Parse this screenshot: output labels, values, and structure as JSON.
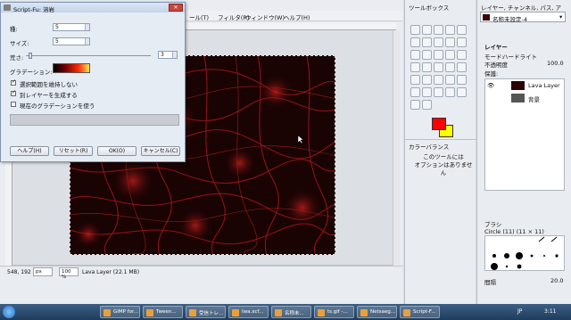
{
  "main": {
    "menus": [
      "ール(T)",
      "フィルタ(R)",
      "ウィンドウ(W)",
      "ヘルプ(H)"
    ],
    "status": {
      "coords": "548, 192",
      "unit": "px",
      "zoom": "100 %",
      "layer": "Lava Layer (22.1 MB)"
    }
  },
  "dialog": {
    "title": "Script-Fu: 溶岩",
    "seed_label": "種:",
    "seed_value": "5",
    "size_label": "サイズ:",
    "size_value": "5",
    "rough_label": "荒さ:",
    "rough_value": "3",
    "gradient_label": "グラデーション:",
    "checks": [
      {
        "label": "選択範囲を維持しない",
        "checked": true
      },
      {
        "label": "別レイヤーを生成する",
        "checked": true
      },
      {
        "label": "現在のグラデーションを使う",
        "checked": false
      }
    ],
    "buttons": {
      "help": "ヘルプ(H)",
      "reset": "リセット(R)",
      "ok": "OK(O)",
      "cancel": "キャンセル(C)"
    }
  },
  "toolbox": {
    "title": "ツールボックス",
    "color_balance": "カラーバランス",
    "hint": "このツールには\nオプションはありません"
  },
  "layers": {
    "title": "レイヤー, チャンネル, パス, アン...",
    "image_name": "名称未設定-4",
    "tab": "レイヤー",
    "mode_label": "モード:",
    "mode_value": "ハードライト",
    "opacity_label": "不透明度",
    "opacity_value": "100.0",
    "lock_label": "保護:",
    "items": [
      {
        "name": "Lava Layer"
      },
      {
        "name": "背景"
      }
    ],
    "brushes_title": "ブラシ",
    "brush_name": "Circle (11) (11 × 11)",
    "spacing_label": "間隔",
    "spacing_value": "20.0"
  },
  "taskbar": {
    "tasks": [
      "GIMP for...",
      "Tween...",
      "受信トレ...",
      "Iwa.xcf...",
      "名称未...",
      "ts.gif -...",
      "Netsaeg...",
      "Script-F..."
    ],
    "lang": "JP",
    "time": "3:11"
  },
  "colors": {
    "fg": "#ff0000",
    "bg": "#ffff00",
    "lava": "#b8191b"
  }
}
